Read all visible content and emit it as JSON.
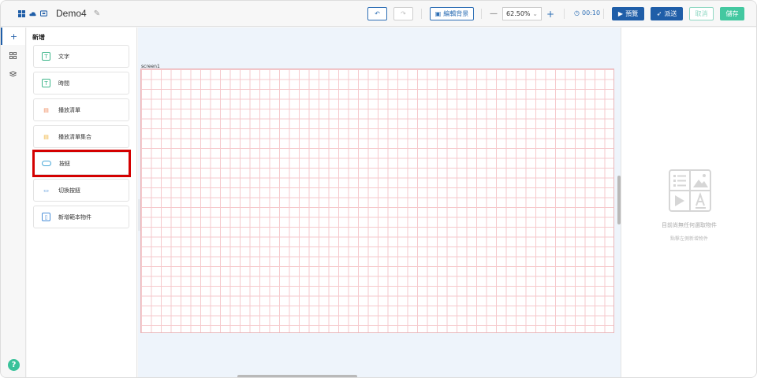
{
  "app": {
    "project_title": "Demo4"
  },
  "toolbar": {
    "edit_background_label": "編輯背景",
    "zoom_value": "62.50%",
    "zoom_minus": "—",
    "zoom_plus": "+",
    "timer": "00:10",
    "preview_label": "預覽",
    "publish_label": "派送",
    "cancel_label": "取消",
    "save_label": "儲存"
  },
  "rail": {
    "add_glyph": "+",
    "help_glyph": "?"
  },
  "panel": {
    "title": "新增",
    "items": [
      {
        "label": "文字",
        "icon": "text-icon",
        "color": "#3fb68b"
      },
      {
        "label": "時間",
        "icon": "clock-icon",
        "color": "#3fb68b"
      },
      {
        "label": "播放清單",
        "icon": "playlist-icon",
        "color": "#f08a5d"
      },
      {
        "label": "播放清單集合",
        "icon": "playlist-collection-icon",
        "color": "#f0b23a"
      },
      {
        "label": "按鈕",
        "icon": "button-icon",
        "color": "#4aa8d8"
      },
      {
        "label": "切換按鈕",
        "icon": "toggle-button-icon",
        "color": "#4a8fd8"
      },
      {
        "label": "新增範本物件",
        "icon": "template-icon",
        "color": "#4a8fd8"
      }
    ]
  },
  "canvas": {
    "screen_name": "screen1"
  },
  "props": {
    "empty_title": "目前尚無任何選取物件",
    "empty_subtitle": "點擊左側新增物件"
  },
  "colors": {
    "brand": "#1f5ea8",
    "accent_green": "#43c8a0",
    "highlight": "#d40000"
  }
}
